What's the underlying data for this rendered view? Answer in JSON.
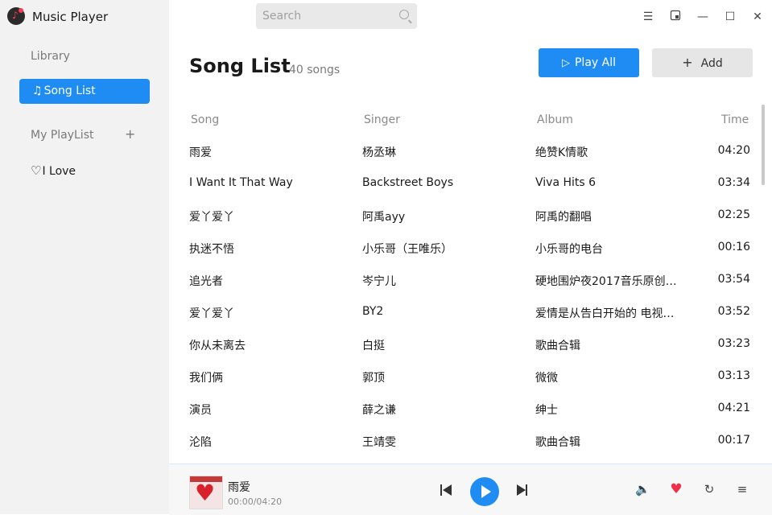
{
  "app": {
    "title": "Music Player"
  },
  "sidebar": {
    "library_label": "Library",
    "song_list_label": "Song List",
    "my_playlist_label": "My PlayList",
    "add_symbol": "+",
    "i_love_label": "I Love"
  },
  "search": {
    "placeholder": "Search"
  },
  "window_controls": {
    "menu": "☰",
    "minimize": "—",
    "maximize": "☐",
    "close": "✕"
  },
  "main": {
    "title": "Song List",
    "count": "40 songs",
    "play_all_label": "Play All",
    "add_label": "Add",
    "columns": {
      "song": "Song",
      "singer": "Singer",
      "album": "Album",
      "time": "Time"
    },
    "rows": [
      {
        "song": "雨爱",
        "singer": "杨丞琳",
        "album": "绝赞K情歌",
        "time": "04:20"
      },
      {
        "song": "I Want It That Way",
        "singer": "Backstreet Boys",
        "album": "Viva Hits 6",
        "time": "03:34"
      },
      {
        "song": "爱丫爱丫",
        "singer": "阿禹ayy",
        "album": "阿禹的翻唱",
        "time": "02:25"
      },
      {
        "song": "执迷不悟",
        "singer": "小乐哥（王唯乐）",
        "album": "小乐哥的电台",
        "time": "00:16"
      },
      {
        "song": "追光者",
        "singer": "岑宁儿",
        "album": "硬地围炉夜2017音乐原创…",
        "time": "03:54"
      },
      {
        "song": "爱丫爱丫",
        "singer": "BY2",
        "album": "爱情是从告白开始的 电视…",
        "time": "03:52"
      },
      {
        "song": "你从未离去",
        "singer": "白挺",
        "album": "歌曲合辑",
        "time": "03:23"
      },
      {
        "song": "我们俩",
        "singer": "郭顶",
        "album": "微微",
        "time": "03:13"
      },
      {
        "song": "演员",
        "singer": "薛之谦",
        "album": "绅士",
        "time": "04:21"
      },
      {
        "song": "沦陷",
        "singer": "王靖雯",
        "album": "歌曲合辑",
        "time": "00:17"
      }
    ]
  },
  "player": {
    "title": "雨爱",
    "time": "00:00/04:20",
    "volume_icon": "🔈",
    "favorite_icon": "♥",
    "repeat_icon": "↻",
    "queue_icon": "≡"
  },
  "colors": {
    "accent": "#1f8cf3",
    "sidebar_bg": "#f2f2f2",
    "favorite": "#f0304a"
  }
}
